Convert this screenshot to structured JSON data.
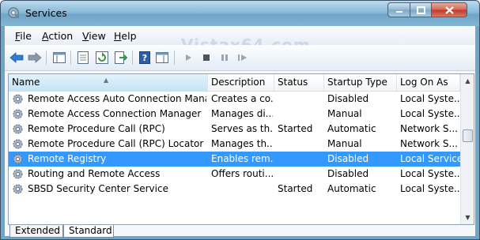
{
  "window": {
    "title": "Services"
  },
  "menubar": [
    {
      "label": "File",
      "key": "F",
      "rest": "ile"
    },
    {
      "label": "Action",
      "key": "A",
      "rest": "ction"
    },
    {
      "label": "View",
      "key": "V",
      "rest": "iew"
    },
    {
      "label": "Help",
      "key": "H",
      "rest": "elp"
    }
  ],
  "watermark": "Vistax64.com",
  "toolbar": [
    "back-icon",
    "forward-icon",
    "console-tree-icon",
    "properties-icon",
    "refresh-icon",
    "export-list-icon",
    "help-icon",
    "show-hide-pane-icon",
    "start-service-icon",
    "stop-service-icon",
    "pause-service-icon",
    "restart-service-icon"
  ],
  "table": {
    "columns": [
      "Name",
      "Description",
      "Status",
      "Startup Type",
      "Log On As"
    ],
    "rows": [
      [
        "Remote Access Auto Connection Manager",
        "Creates a co...",
        "",
        "Disabled",
        "Local Syste..."
      ],
      [
        "Remote Access Connection Manager",
        "Manages di...",
        "",
        "Manual",
        "Local Syste..."
      ],
      [
        "Remote Procedure Call (RPC)",
        "Serves as th...",
        "Started",
        "Automatic",
        "Network S..."
      ],
      [
        "Remote Procedure Call (RPC) Locator",
        "Manages th...",
        "",
        "Manual",
        "Network S..."
      ],
      [
        "Remote Registry",
        "Enables rem...",
        "",
        "Disabled",
        "Local Service"
      ],
      [
        "Routing and Remote Access",
        "Offers routi...",
        "",
        "Disabled",
        "Local Syste..."
      ],
      [
        "SBSD Security Center Service",
        "",
        "Started",
        "Automatic",
        "Local Syste..."
      ]
    ],
    "selected_row": 4
  },
  "tabs": [
    "Extended",
    "Standard"
  ],
  "active_tab": 1
}
